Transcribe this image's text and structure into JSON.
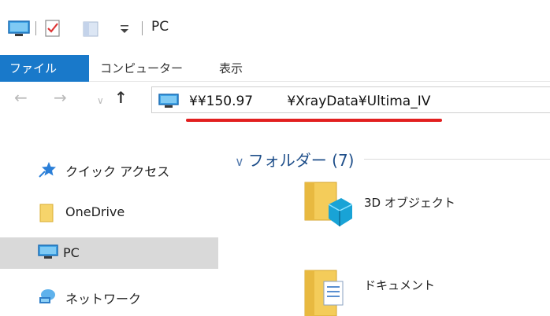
{
  "window": {
    "title": "PC",
    "qat_icons": [
      "pc-icon",
      "properties-icon",
      "new-folder-icon",
      "customize-qat-icon"
    ]
  },
  "ribbon": {
    "tabs": [
      "ファイル",
      "コンピューター",
      "表示"
    ],
    "active_tab": "ファイル",
    "active_color": "#1979ca"
  },
  "address_bar": {
    "path": "¥¥150.97        ¥XrayData¥Ultima_IV",
    "underline_color": "#e21f1f"
  },
  "navigation": {
    "back_icon": "arrow-left-icon",
    "forward_icon": "arrow-right-icon",
    "recent_icon": "chevron-down-icon",
    "up_icon": "arrow-up-icon"
  },
  "sidebar": {
    "items": [
      {
        "label": "クイック アクセス",
        "icon": "star-icon"
      },
      {
        "label": "OneDrive",
        "icon": "folder-icon"
      },
      {
        "label": "PC",
        "icon": "pc-icon",
        "selected": true
      },
      {
        "label": "ネットワーク",
        "icon": "network-icon"
      }
    ]
  },
  "main": {
    "group_header": "フォルダー (7)",
    "folders": [
      {
        "label": "3D オブジェクト",
        "icon": "3d-objects-folder-icon"
      },
      {
        "label": "ドキュメント",
        "icon": "documents-folder-icon"
      }
    ]
  }
}
